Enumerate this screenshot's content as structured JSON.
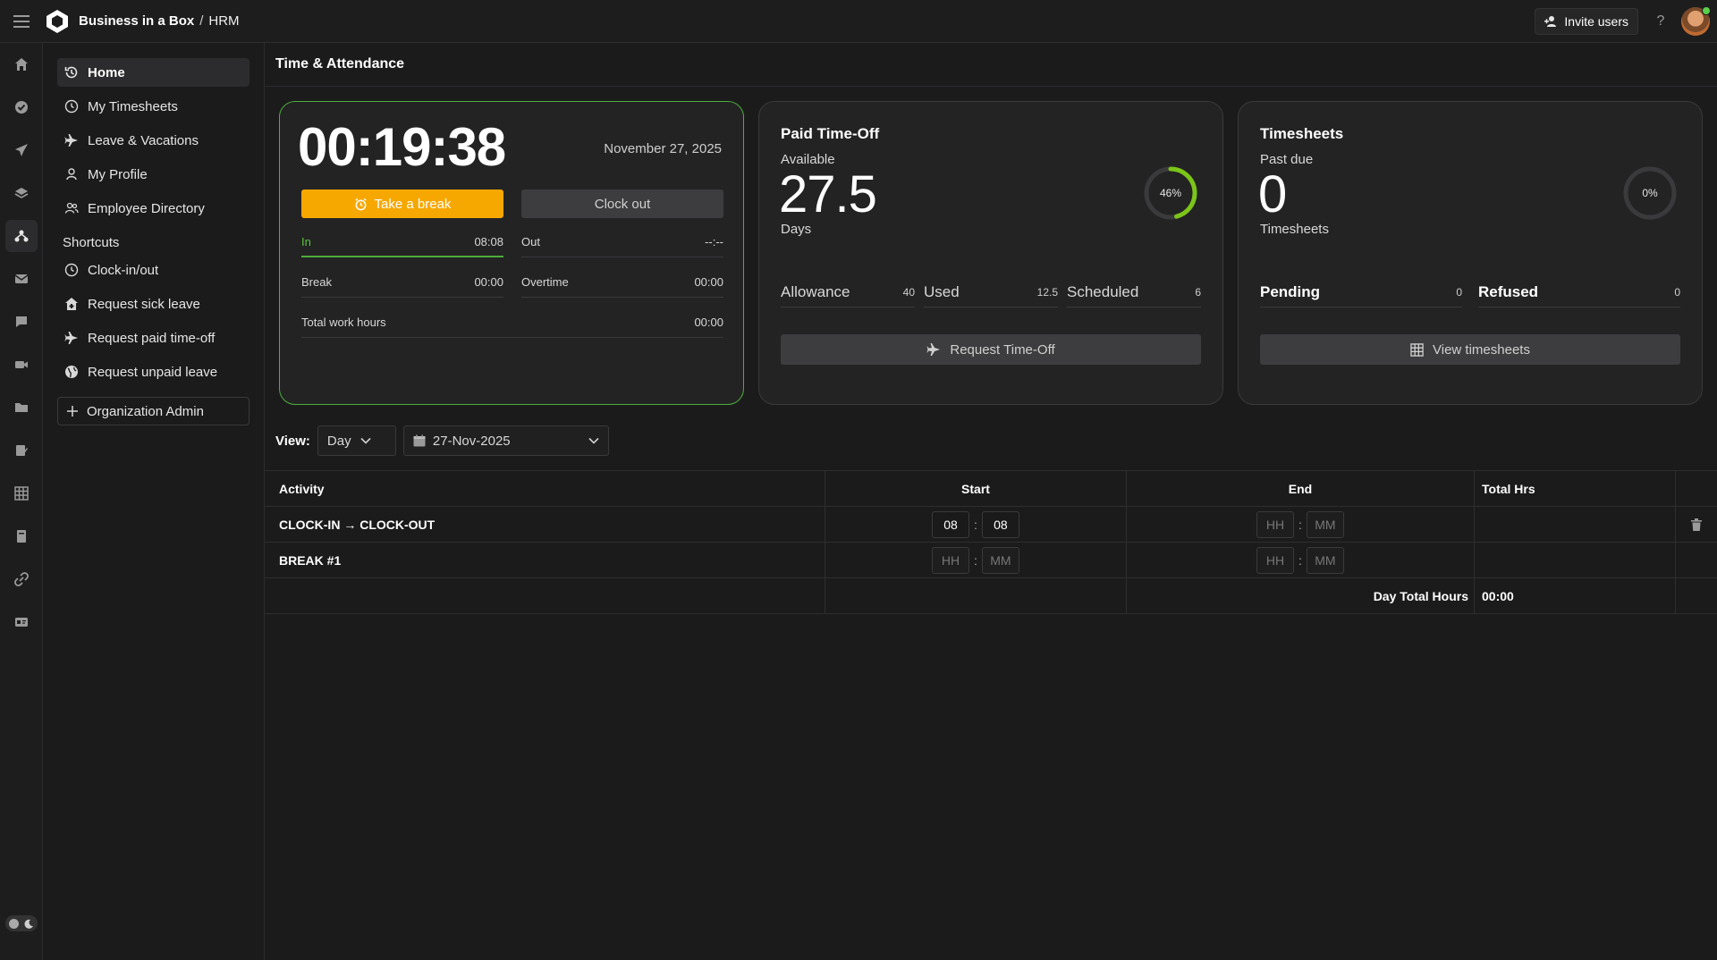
{
  "header": {
    "brand": "Business in a Box",
    "separator": "/",
    "module": "HRM",
    "invite_label": "Invite users",
    "help_label": "?"
  },
  "rail": {
    "icons": [
      "home-icon",
      "check-circle-icon",
      "plane-icon",
      "layers-icon",
      "people-network-icon",
      "mail-icon",
      "chat-icon",
      "video-icon",
      "folder-icon",
      "edit-icon",
      "grid-icon",
      "book-icon",
      "link-icon",
      "id-card-icon"
    ],
    "active_index": 4
  },
  "nav": {
    "items": [
      {
        "label": "Home",
        "icon": "history-icon",
        "active": true
      },
      {
        "label": "My Timesheets",
        "icon": "clock-icon"
      },
      {
        "label": "Leave & Vacations",
        "icon": "plane-icon"
      },
      {
        "label": "My Profile",
        "icon": "user-icon"
      },
      {
        "label": "Employee Directory",
        "icon": "users-icon"
      }
    ],
    "shortcuts_heading": "Shortcuts",
    "shortcuts": [
      {
        "label": "Clock-in/out",
        "icon": "clock-icon"
      },
      {
        "label": "Request sick leave",
        "icon": "medical-house-icon"
      },
      {
        "label": "Request paid time-off",
        "icon": "plane-icon"
      },
      {
        "label": "Request unpaid leave",
        "icon": "globe-icon"
      }
    ],
    "org_admin_label": "Organization Admin"
  },
  "page": {
    "title": "Time & Attendance"
  },
  "clock_card": {
    "time": "00:19:38",
    "date": "November 27, 2025",
    "break_button": "Take a break",
    "clockout_button": "Clock out",
    "in_label": "In",
    "in_value": "08:08",
    "out_label": "Out",
    "out_value": "--:--",
    "break_label": "Break",
    "break_value": "00:00",
    "overtime_label": "Overtime",
    "overtime_value": "00:00",
    "total_label": "Total work hours",
    "total_value": "00:00"
  },
  "pto_card": {
    "title": "Paid Time-Off",
    "available_label": "Available",
    "available_value": "27.5",
    "unit": "Days",
    "percent_label": "46%",
    "percent": 0.46,
    "allowance_label": "Allowance",
    "allowance_value": "40",
    "used_label": "Used",
    "used_value": "12.5",
    "scheduled_label": "Scheduled",
    "scheduled_value": "6",
    "button": "Request Time-Off"
  },
  "timesheets_card": {
    "title": "Timesheets",
    "pastdue_label": "Past due",
    "pastdue_value": "0",
    "unit": "Timesheets",
    "percent_label": "0%",
    "percent": 0,
    "pending_label": "Pending",
    "pending_value": "0",
    "refused_label": "Refused",
    "refused_value": "0",
    "button": "View timesheets"
  },
  "view": {
    "label": "View:",
    "mode": "Day",
    "date": "27-Nov-2025"
  },
  "table": {
    "headers": {
      "activity": "Activity",
      "start": "Start",
      "end": "End",
      "total": "Total Hrs"
    },
    "colon": ":",
    "rows": [
      {
        "activity": "CLOCK-IN → CLOCK-OUT",
        "start_hh": "08",
        "start_mm": "08",
        "end_hh": "HH",
        "end_mm": "MM"
      },
      {
        "activity": "BREAK #1",
        "start_hh": "HH",
        "start_mm": "MM",
        "end_hh": "HH",
        "end_mm": "MM"
      }
    ],
    "day_total_label": "Day Total Hours",
    "day_total_value": "00:00"
  },
  "colors": {
    "accent_orange": "#f7a800",
    "accent_green": "#4caf3a",
    "ring_green": "#7cc518",
    "bg": "#1b1b1c"
  }
}
